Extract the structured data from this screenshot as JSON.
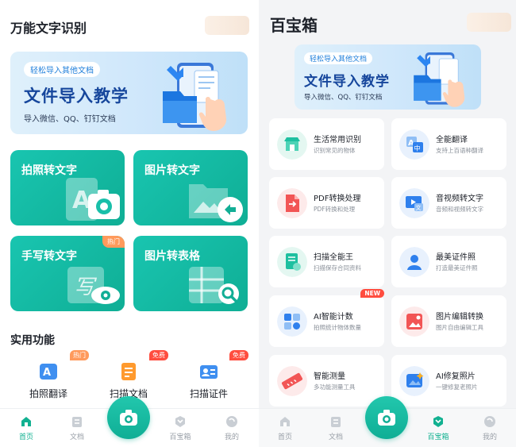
{
  "left": {
    "title": "万能文字识别",
    "banner": {
      "tag": "轻松导入其他文档",
      "title": "文件导入教学",
      "subtitle": "导入微信、QQ、钉钉文档"
    },
    "features": [
      {
        "label": "拍照转文字"
      },
      {
        "label": "图片转文字"
      },
      {
        "label": "手写转文字",
        "badge": "热门"
      },
      {
        "label": "图片转表格"
      }
    ],
    "section_title": "实用功能",
    "tools": [
      {
        "label": "拍照翻译",
        "badge": "热门"
      },
      {
        "label": "扫描文档",
        "badge": "免费"
      },
      {
        "label": "扫描证件",
        "badge": "免费"
      }
    ],
    "nav": [
      {
        "label": "首页",
        "active": true
      },
      {
        "label": "文档"
      },
      {
        "label": "百宝箱"
      },
      {
        "label": "我的"
      }
    ]
  },
  "right": {
    "title": "百宝箱",
    "banner": {
      "tag": "轻松导入其他文档",
      "title": "文件导入教学",
      "subtitle": "导入微信、QQ、钉钉文档"
    },
    "tools": [
      {
        "title": "生活常用识别",
        "subtitle": "识别常见的物体"
      },
      {
        "title": "全能翻译",
        "subtitle": "支持上百语种翻译"
      },
      {
        "title": "PDF转换处理",
        "subtitle": "PDF转换和处理"
      },
      {
        "title": "音视频转文字",
        "subtitle": "音频和视频转文字"
      },
      {
        "title": "扫描全能王",
        "subtitle": "扫描保存合同资料"
      },
      {
        "title": "最美证件照",
        "subtitle": "打造最美证件照"
      },
      {
        "title": "AI智能计数",
        "subtitle": "拍照统计物体数量",
        "badge": "NEW"
      },
      {
        "title": "图片编辑转换",
        "subtitle": "图片自由编辑工具"
      },
      {
        "title": "智能测量",
        "subtitle": "多功能测量工具"
      },
      {
        "title": "AI修复照片",
        "subtitle": "一键修复老照片"
      }
    ],
    "nav": [
      {
        "label": "首页"
      },
      {
        "label": "文档"
      },
      {
        "label": "百宝箱",
        "active": true
      },
      {
        "label": "我的"
      }
    ]
  },
  "colors": {
    "accent": "#12b191",
    "card_green": "#19c5b0",
    "banner_title": "#16469c",
    "hot": "#ff9a5c",
    "free": "#ff4d3f"
  },
  "icons": {
    "camera": "camera-icon",
    "home": "home-icon",
    "document": "document-icon",
    "toolbox": "toolbox-icon",
    "profile": "profile-icon"
  }
}
